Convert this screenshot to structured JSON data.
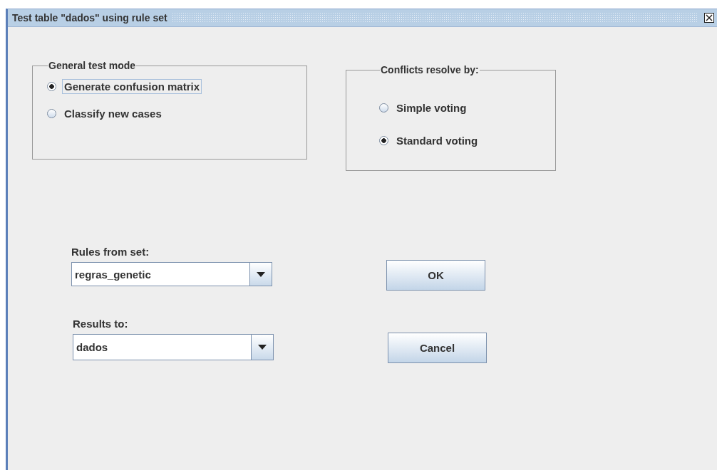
{
  "window": {
    "title": "Test table \"dados\" using rule set"
  },
  "groups": [
    {
      "title": "General test mode",
      "options": [
        {
          "label": "Generate confusion matrix",
          "selected": true,
          "focused": true
        },
        {
          "label": "Classify new cases",
          "selected": false,
          "focused": false
        }
      ]
    },
    {
      "title": "Conflicts resolve by:",
      "options": [
        {
          "label": "Simple voting",
          "selected": false,
          "focused": false
        },
        {
          "label": "Standard voting",
          "selected": true,
          "focused": false
        }
      ]
    }
  ],
  "rows": [
    {
      "label": "Rules from set:",
      "value": "regras_genetic",
      "button": "OK"
    },
    {
      "label": "Results to:",
      "value": "dados",
      "button": "Cancel"
    }
  ]
}
